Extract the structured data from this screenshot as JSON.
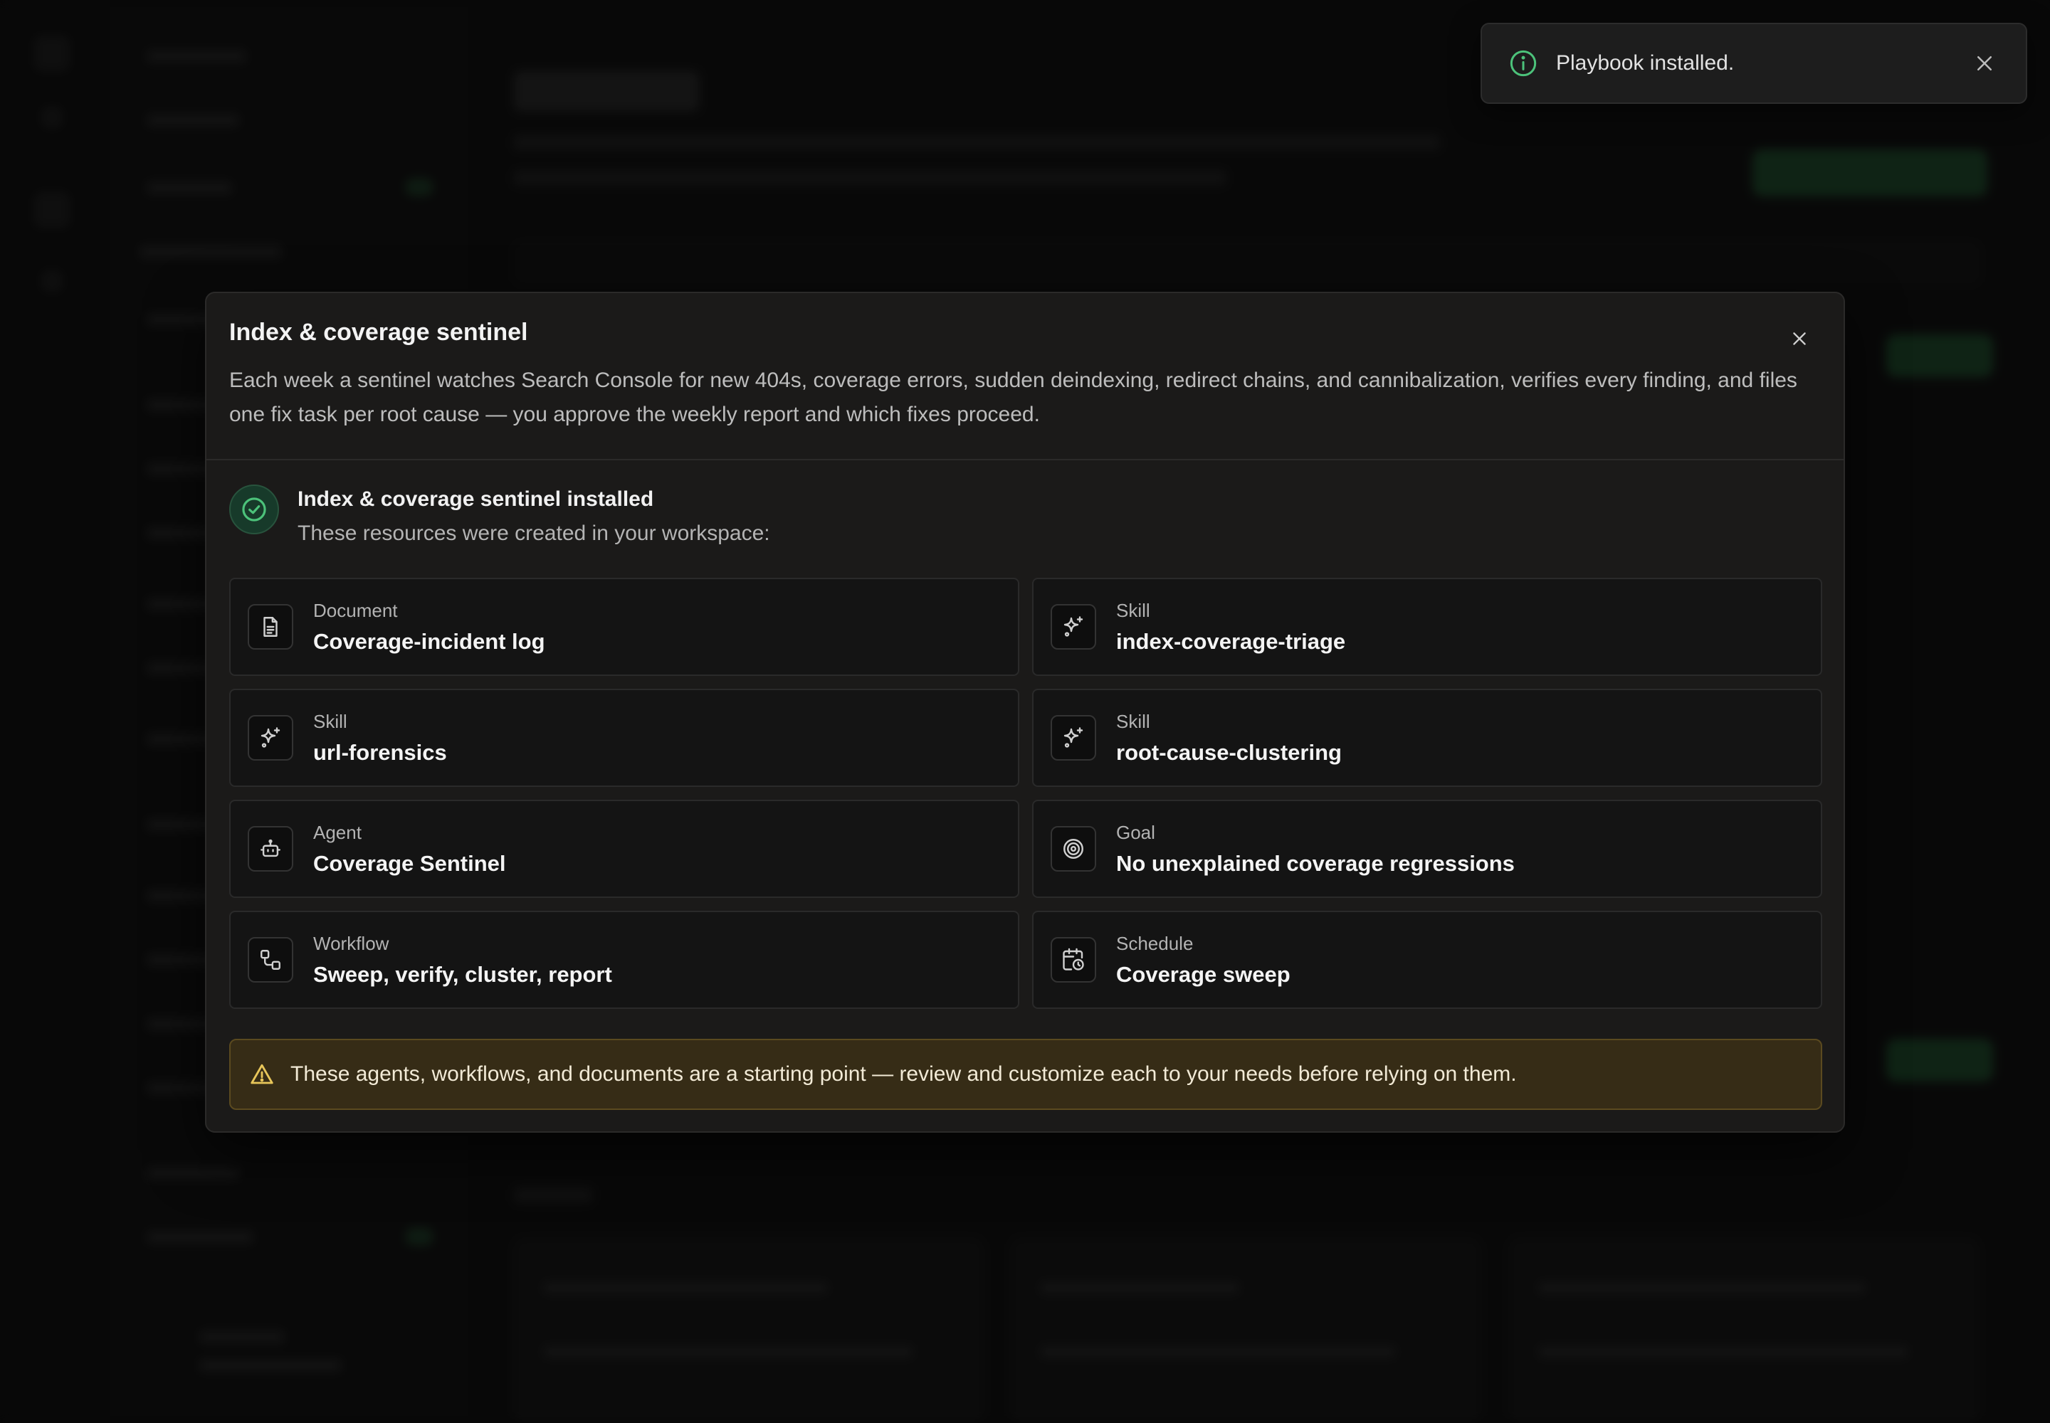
{
  "toast": {
    "message": "Playbook installed.",
    "icon": "info-icon",
    "icon_color": "#4cc27a"
  },
  "modal": {
    "title": "Index & coverage sentinel",
    "description": "Each week a sentinel watches Search Console for new 404s, coverage errors, sudden deindexing, redirect chains, and cannibalization, verifies every finding, and files one fix task per root cause — you approve the weekly report and which fixes proceed.",
    "success": {
      "title": "Index & coverage sentinel installed",
      "subtitle": "These resources were created in your workspace:",
      "color": "#4cc27a"
    },
    "resources": [
      {
        "type": "Document",
        "name": "Coverage-incident log",
        "icon": "document-icon"
      },
      {
        "type": "Skill",
        "name": "index-coverage-triage",
        "icon": "sparkle-icon"
      },
      {
        "type": "Skill",
        "name": "url-forensics",
        "icon": "sparkle-icon"
      },
      {
        "type": "Skill",
        "name": "root-cause-clustering",
        "icon": "sparkle-icon"
      },
      {
        "type": "Agent",
        "name": "Coverage Sentinel",
        "icon": "robot-icon"
      },
      {
        "type": "Goal",
        "name": "No unexplained coverage regressions",
        "icon": "target-icon"
      },
      {
        "type": "Workflow",
        "name": "Sweep, verify, cluster, report",
        "icon": "workflow-icon"
      },
      {
        "type": "Schedule",
        "name": "Coverage sweep",
        "icon": "calendar-clock-icon"
      }
    ],
    "warning": {
      "text": "These agents, workflows, and documents are a starting point — review and customize each to your needs before relying on them.",
      "color": "#e8c65a"
    }
  }
}
